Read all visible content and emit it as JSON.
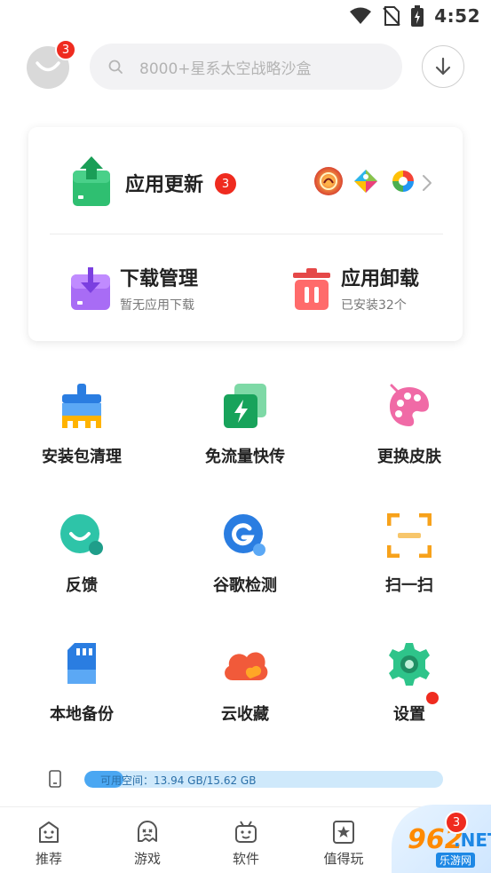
{
  "status": {
    "time": "4:52"
  },
  "header": {
    "avatar_badge": "3",
    "search_placeholder": "8000+星系太空战略沙盒"
  },
  "updates": {
    "title": "应用更新",
    "badge": "3",
    "app_icon_names": [
      "game-app-icon",
      "puzzle-app-icon",
      "swirl-app-icon"
    ]
  },
  "manager": {
    "download_title": "下载管理",
    "download_sub": "暂无应用下载",
    "uninstall_title": "应用卸载",
    "uninstall_sub": "已安装32个"
  },
  "tools": [
    {
      "label": "安装包清理",
      "icon": "broom-icon"
    },
    {
      "label": "免流量快传",
      "icon": "fast-transfer-icon"
    },
    {
      "label": "更换皮肤",
      "icon": "palette-icon"
    },
    {
      "label": "反馈",
      "icon": "feedback-icon"
    },
    {
      "label": "谷歌检测",
      "icon": "google-check-icon"
    },
    {
      "label": "扫一扫",
      "icon": "scan-icon"
    },
    {
      "label": "本地备份",
      "icon": "sd-card-icon"
    },
    {
      "label": "云收藏",
      "icon": "cloud-icon"
    },
    {
      "label": "设置",
      "icon": "gear-icon"
    }
  ],
  "storage": {
    "text": "可用空间：13.94 GB/15.62 GB",
    "used_fraction": 0.11
  },
  "nav": {
    "items": [
      {
        "label": "推荐",
        "icon": "recommend-icon"
      },
      {
        "label": "游戏",
        "icon": "game-ghost-icon"
      },
      {
        "label": "软件",
        "icon": "software-icon"
      },
      {
        "label": "值得玩",
        "icon": "star-bookmark-icon"
      }
    ],
    "badge": "3"
  },
  "watermark": {
    "num": "962",
    "net": ".NET",
    "sub": "乐游网"
  },
  "colors": {
    "badge": "#ef2b1f",
    "accent_blue": "#4aa7f2"
  }
}
